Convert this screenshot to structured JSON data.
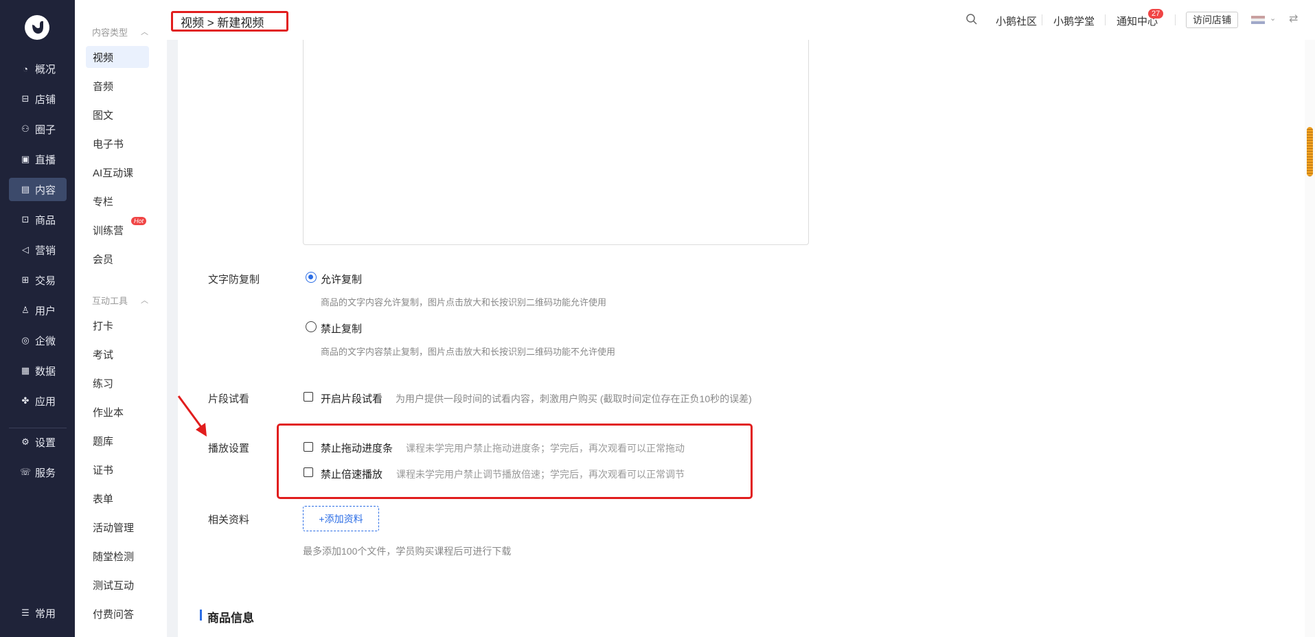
{
  "left_nav": {
    "items": [
      {
        "icon": "chart-pie-icon",
        "glyph": "◔",
        "label": "概况"
      },
      {
        "icon": "store-icon",
        "glyph": "⊟",
        "label": "店铺"
      },
      {
        "icon": "group-icon",
        "glyph": "⚇",
        "label": "圈子"
      },
      {
        "icon": "live-icon",
        "glyph": "▣",
        "label": "直播"
      },
      {
        "icon": "content-icon",
        "glyph": "▤",
        "label": "内容"
      },
      {
        "icon": "goods-icon",
        "glyph": "⊡",
        "label": "商品"
      },
      {
        "icon": "marketing-icon",
        "glyph": "◁",
        "label": "营销"
      },
      {
        "icon": "trade-icon",
        "glyph": "⊞",
        "label": "交易"
      },
      {
        "icon": "user-icon",
        "glyph": "♙",
        "label": "用户"
      },
      {
        "icon": "wecom-icon",
        "glyph": "◎",
        "label": "企微"
      },
      {
        "icon": "data-icon",
        "glyph": "▦",
        "label": "数据"
      },
      {
        "icon": "apps-icon",
        "glyph": "✤",
        "label": "应用"
      },
      {
        "icon": "gear-icon",
        "glyph": "⚙",
        "label": "设置"
      },
      {
        "icon": "service-icon",
        "glyph": "☏",
        "label": "服务"
      }
    ],
    "active": "内容",
    "bottom": {
      "icon": "list-icon",
      "glyph": "☰",
      "label": "常用"
    }
  },
  "sub_nav": {
    "groups": [
      {
        "title": "内容类型",
        "items": [
          "视频",
          "音频",
          "图文",
          "电子书",
          "AI互动课",
          "专栏",
          "训练营",
          "会员"
        ]
      },
      {
        "title": "互动工具",
        "items": [
          "打卡",
          "考试",
          "练习",
          "作业本",
          "题库",
          "证书",
          "表单",
          "活动管理",
          "随堂检测",
          "测试互动",
          "付费问答"
        ]
      }
    ],
    "active": "视频",
    "hot_badge": "Hot"
  },
  "header": {
    "breadcrumb": "视频 > 新建视频",
    "links": [
      "小鹅社区",
      "小鹅学堂",
      "通知中心"
    ],
    "notification_count": "27",
    "visit_button": "访问店铺"
  },
  "form": {
    "copy_protect": {
      "label": "文字防复制",
      "options": [
        {
          "label": "允许复制",
          "hint": "商品的文字内容允许复制，图片点击放大和长按识别二维码功能允许使用",
          "selected": true
        },
        {
          "label": "禁止复制",
          "hint": "商品的文字内容禁止复制，图片点击放大和长按识别二维码功能不允许使用",
          "selected": false
        }
      ]
    },
    "trial": {
      "label": "片段试看",
      "checkbox": "开启片段试看",
      "hint": "为用户提供一段时间的试看内容，刺激用户购买 (截取时间定位存在正负10秒的误差)"
    },
    "playback": {
      "label": "播放设置",
      "options": [
        {
          "label": "禁止拖动进度条",
          "hint": "课程未学完用户禁止拖动进度条；学完后，再次观看可以正常拖动"
        },
        {
          "label": "禁止倍速播放",
          "hint": "课程未学完用户禁止调节播放倍速；学完后，再次观看可以正常调节"
        }
      ]
    },
    "materials": {
      "label": "相关资料",
      "button": "+添加资料",
      "hint": "最多添加100个文件，学员购买课程后可进行下载"
    },
    "section_title": "商品信息"
  }
}
